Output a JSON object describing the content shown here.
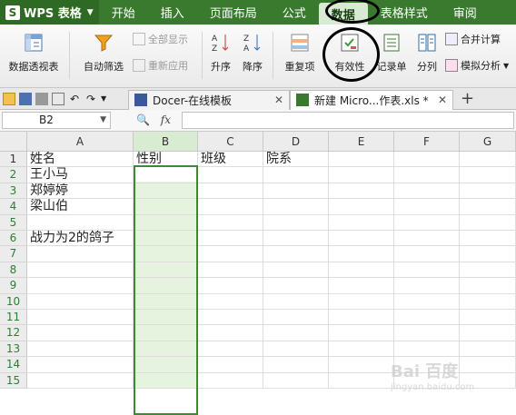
{
  "app": {
    "name": "WPS 表格",
    "logo_letter": "S"
  },
  "menu": {
    "tabs": [
      "开始",
      "插入",
      "页面布局",
      "公式",
      "数据",
      "表格样式",
      "审阅"
    ],
    "active_tab": "数据"
  },
  "ribbon": {
    "pivot": "数据透视表",
    "autofilter": "自动筛选",
    "show_all": "全部显示",
    "reapply": "重新应用",
    "sort_asc": "升序",
    "sort_desc": "降序",
    "duplicates": "重复项",
    "validation": "有效性",
    "record": "记录单",
    "split": "分列",
    "merge_calc": "合并计算",
    "what_if": "模拟分析"
  },
  "tabs": {
    "docer": "Docer-在线模板",
    "file": "新建 Micro...作表.xls *"
  },
  "formula_bar": {
    "name_box": "B2",
    "fx": "fx",
    "value": ""
  },
  "grid": {
    "columns": [
      "A",
      "B",
      "C",
      "D",
      "E",
      "F",
      "G"
    ],
    "rows": [
      "1",
      "2",
      "3",
      "4",
      "5",
      "6",
      "7",
      "8",
      "9",
      "10",
      "11",
      "12",
      "13",
      "14",
      "15"
    ],
    "cells": {
      "A1": "姓名",
      "B1": "性别",
      "C1": "班级",
      "D1": "院系",
      "A2": "王小马",
      "A3": "郑婷婷",
      "A4": "梁山伯",
      "A6": "战力为2的鸽子"
    }
  },
  "watermark": {
    "text": "Bai 百度",
    "sub": "jingyan.baidu.com"
  },
  "colors": {
    "menubar": "#3a7a2f",
    "selection": "#3d8a34",
    "selection_fill": "#e6f3df"
  }
}
